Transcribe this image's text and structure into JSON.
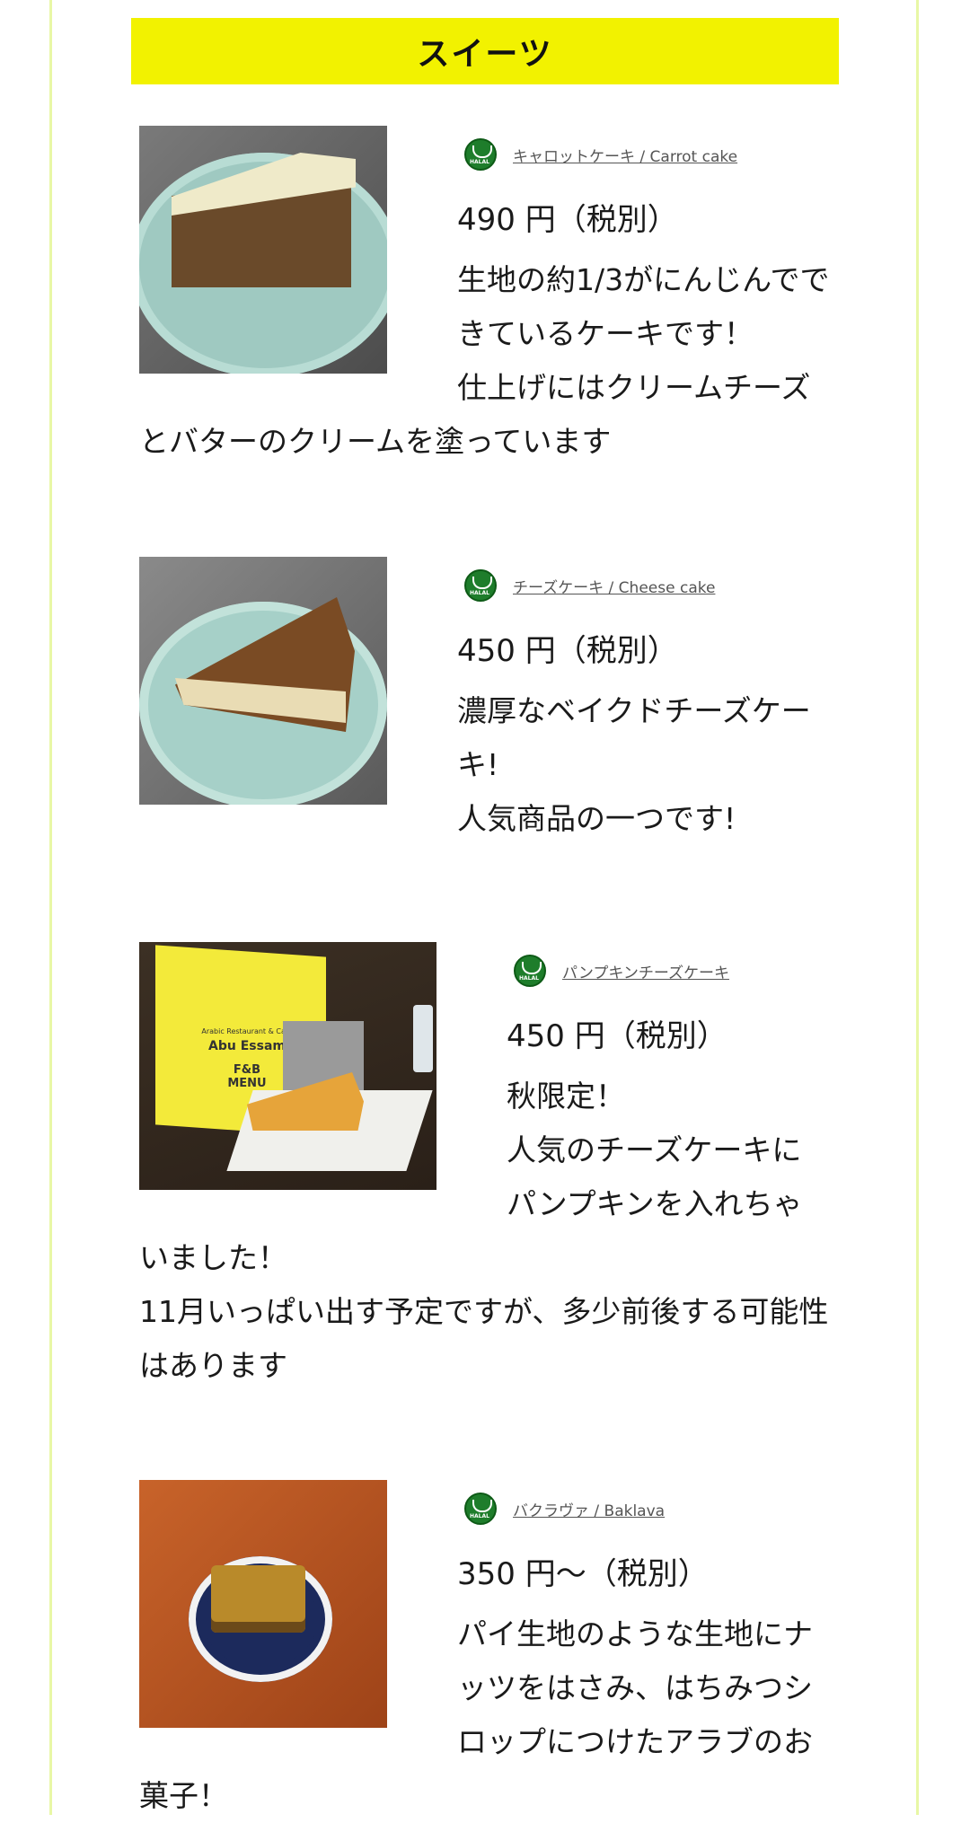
{
  "section": {
    "title": "スイーツ"
  },
  "colors": {
    "title_bg": "#f2f200",
    "frame": "#e8f7a6",
    "halal": "#1e7d2b"
  },
  "items": [
    {
      "name": "キャロットケーキ / Carrot cake",
      "price": "490 円（税別）",
      "desc": [
        "生地の約1/3がにんじんでできているケーキです！",
        "仕上げにはクリームチーズとバターのクリームを塗っています"
      ]
    },
    {
      "name": "チーズケーキ / Cheese cake",
      "price": "450 円（税別）",
      "desc": [
        "濃厚なベイクドチーズケーキ!",
        "人気商品の一つです!"
      ]
    },
    {
      "name": "パンプキンチーズケーキ",
      "price": "450 円（税別）",
      "desc": [
        "秋限定！",
        "人気のチーズケーキにパンプキンを入れちゃいました！",
        "11月いっぱい出す予定ですが、多少前後する可能性はあります"
      ],
      "photo_text": {
        "line1": "Arabic Restaurant & Cafe",
        "line2": "Abu Essam",
        "line3": "F&B",
        "line4": "MENU"
      }
    },
    {
      "name": "バクラヴァ / Baklava",
      "price": "350 円〜（税別）",
      "desc": [
        "パイ生地のような生地にナッツをはさみ、はちみつシロップにつけたアラブのお菓子！"
      ]
    }
  ]
}
